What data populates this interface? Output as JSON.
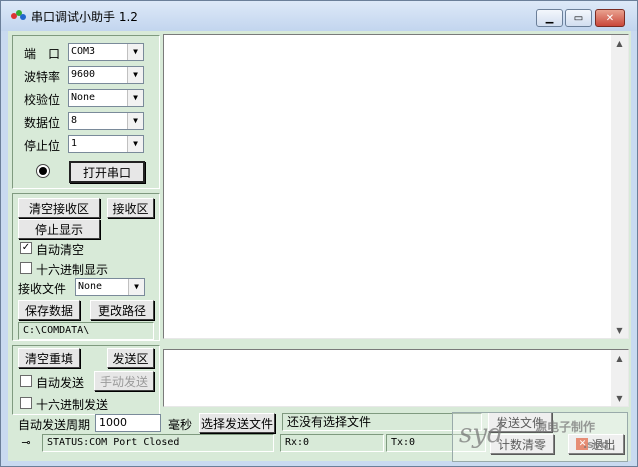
{
  "window": {
    "title": "串口调试小助手 1.2"
  },
  "port_settings": {
    "port": {
      "label": "端　口",
      "value": "COM3"
    },
    "baud": {
      "label": "波特率",
      "value": "9600"
    },
    "parity": {
      "label": "校验位",
      "value": "None"
    },
    "databits": {
      "label": "数据位",
      "value": "8"
    },
    "stopbits": {
      "label": "停止位",
      "value": "1"
    },
    "open_button": "打开串口"
  },
  "receive": {
    "clear_button": "清空接收区",
    "area_label": "接收区",
    "stop_display_button": "停止显示",
    "auto_clear_label": "自动清空",
    "auto_clear_checked": true,
    "hex_display_label": "十六进制显示",
    "hex_display_checked": false,
    "file_label": "接收文件",
    "file_format": "None",
    "save_button": "保存数据",
    "change_path_button": "更改路径",
    "path": "C:\\COMDATA\\"
  },
  "send": {
    "clear_button": "清空重填",
    "area_label": "发送区",
    "auto_send_label": "自动发送",
    "manual_send_button": "手动发送",
    "hex_send_label": "十六进制发送",
    "period_label": "自动发送周期",
    "period_value": "1000",
    "period_unit": "毫秒",
    "choose_file_button": "选择发送文件",
    "file_status": "还没有选择文件",
    "send_file_button": "发送文件",
    "reset_count_button": "计数清零",
    "exit_button": "退出"
  },
  "status": {
    "text": "STATUS:COM Port Closed",
    "rx": "Rx:0",
    "tx": "Tx:0"
  },
  "watermark": {
    "text": "syd",
    "caption": "源电子制作",
    "url_fragment": ".syd"
  }
}
